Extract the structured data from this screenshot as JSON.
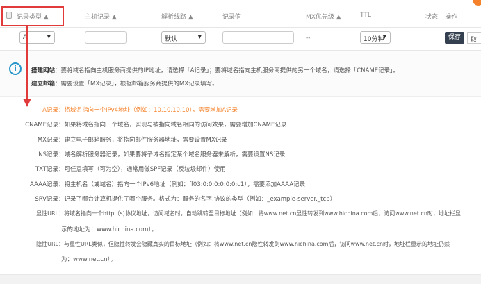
{
  "header": {
    "columns": [
      "记录类型 ▲",
      "主机记录 ▲",
      "解析线路 ▲",
      "记录值",
      "MX优先级 ▲",
      "TTL",
      "状态",
      "操作"
    ]
  },
  "form": {
    "record_type": "A",
    "host": "",
    "line": "默认",
    "value": "",
    "mx": "--",
    "ttl": "10分钟",
    "save": "保存",
    "cancel": "取"
  },
  "info": {
    "lines": [
      {
        "label": "搭建网站",
        "text": "：要将域名指向主机服务商提供的IP地址，请选择「A记录」；要将域名指向主机服务商提供的另一个域名，请选择「CNAME记录」。"
      },
      {
        "label": "建立邮箱",
        "text": "：需要设置「MX记录」，根据邮箱服务商提供的MX记录填写。"
      }
    ]
  },
  "descriptions": [
    {
      "label": "A记录",
      "text": "：将域名指向一个IPv4地址（例如：10.10.10.10），需要增加A记录",
      "highlight": true
    },
    {
      "label": "CNAME记录",
      "text": "：如果将域名指向一个域名，实现与被指向域名相同的访问效果，需要增加CNAME记录"
    },
    {
      "label": "MX记录",
      "text": "：建立电子邮箱服务，将指向邮件服务器地址，需要设置MX记录"
    },
    {
      "label": "NS记录",
      "text": "：域名解析服务器记录，如果要将子域名指定某个域名服务器来解析，需要设置NS记录"
    },
    {
      "label": "TXT记录",
      "text": "：可任意填写（可为空），通常用做SPF记录（反垃圾邮件）使用"
    },
    {
      "label": "AAAA记录",
      "text": "：将主机名（或域名）指向一个IPv6地址（例如：ff03:0:0:0:0:0:0:c1），需要添加AAAA记录"
    },
    {
      "label": "SRV记录",
      "text": "：记录了哪台计算机提供了哪个服务。格式为：服务的名字.协议的类型（例如：_example-server._tcp）"
    },
    {
      "label": "显性URL",
      "text": "：将域名指向一个http（s)协议地址，访问域名时，自动跳转至目标地址（例如：将www.net.cn显性转发到www.hichina.com后，访问www.net.cn时，地址栏显",
      "cont": "示的地址为：www.hichina.com）。"
    },
    {
      "label": "隐性URL",
      "text": "：与显性URL类似，但隐性转发会隐藏真实的目标地址（例如：将www.net.cn隐性转发到www.hichina.com后，访问www.net.cn时，地址栏显示的地址仍然",
      "cont": "为：www.net.cn）。"
    }
  ],
  "colors": {
    "accent": "#f5822a",
    "annotation": "#e03a3a",
    "save_bg": "#34404f",
    "info_icon": "#2a95c9"
  }
}
